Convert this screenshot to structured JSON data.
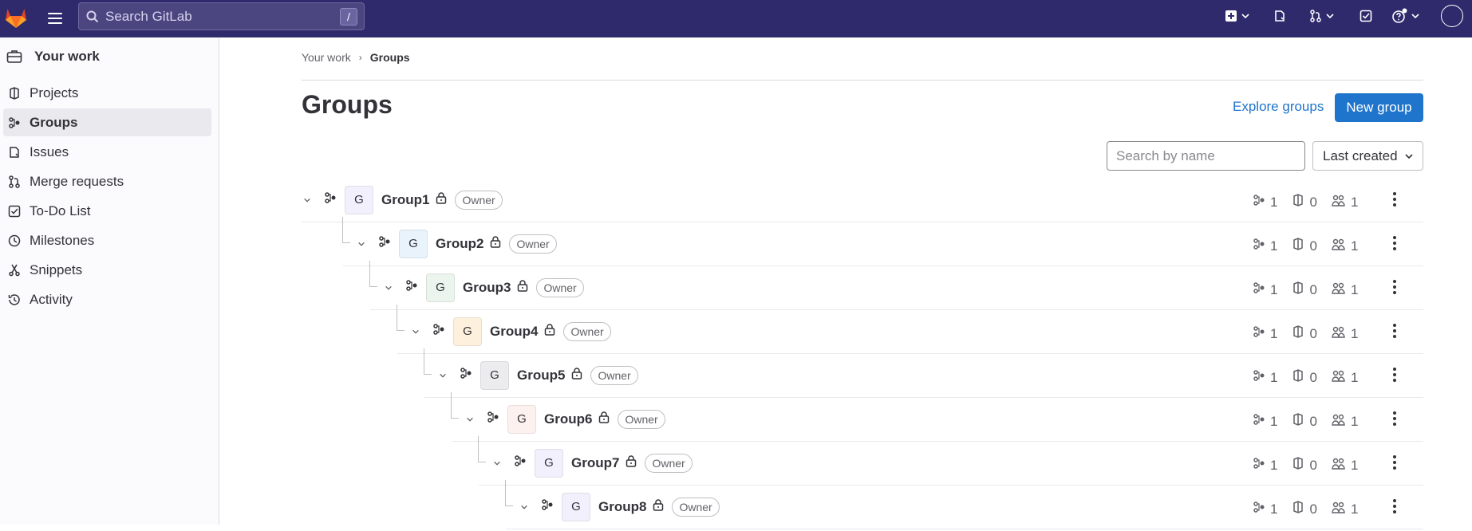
{
  "topbar": {
    "search_placeholder": "Search GitLab",
    "search_shortcut": "/",
    "icons": [
      "gitlab-logo",
      "menu-icon",
      "search-icon",
      "plus-square-icon",
      "issues-icon",
      "merge-request-icon",
      "todo-icon",
      "help-icon",
      "avatar"
    ]
  },
  "sidebar": {
    "title": "Your work",
    "items": [
      {
        "label": "Projects",
        "icon": "project-icon"
      },
      {
        "label": "Groups",
        "icon": "group-icon",
        "active": true
      },
      {
        "label": "Issues",
        "icon": "issues-icon"
      },
      {
        "label": "Merge requests",
        "icon": "merge-request-icon"
      },
      {
        "label": "To-Do List",
        "icon": "todo-icon"
      },
      {
        "label": "Milestones",
        "icon": "clock-icon"
      },
      {
        "label": "Snippets",
        "icon": "snippet-icon"
      },
      {
        "label": "Activity",
        "icon": "history-icon"
      }
    ]
  },
  "breadcrumb": {
    "root": "Your work",
    "current": "Groups"
  },
  "page": {
    "title": "Groups",
    "explore_label": "Explore groups",
    "new_group_label": "New group",
    "search_placeholder": "Search by name",
    "sort_label": "Last created"
  },
  "groups": [
    {
      "name": "Group1",
      "avatar": "G",
      "role": "Owner",
      "subgroups": "1",
      "projects": "0",
      "members": "1",
      "color": "#f2f0fc"
    },
    {
      "name": "Group2",
      "avatar": "G",
      "role": "Owner",
      "subgroups": "1",
      "projects": "0",
      "members": "1",
      "color": "#e9f3fc"
    },
    {
      "name": "Group3",
      "avatar": "G",
      "role": "Owner",
      "subgroups": "1",
      "projects": "0",
      "members": "1",
      "color": "#ecf4ee"
    },
    {
      "name": "Group4",
      "avatar": "G",
      "role": "Owner",
      "subgroups": "1",
      "projects": "0",
      "members": "1",
      "color": "#fdf1dd"
    },
    {
      "name": "Group5",
      "avatar": "G",
      "role": "Owner",
      "subgroups": "1",
      "projects": "0",
      "members": "1",
      "color": "#ececef"
    },
    {
      "name": "Group6",
      "avatar": "G",
      "role": "Owner",
      "subgroups": "1",
      "projects": "0",
      "members": "1",
      "color": "#fcf1ef"
    },
    {
      "name": "Group7",
      "avatar": "G",
      "role": "Owner",
      "subgroups": "1",
      "projects": "0",
      "members": "1",
      "color": "#f2f0fc"
    },
    {
      "name": "Group8",
      "avatar": "G",
      "role": "Owner",
      "subgroups": "1",
      "projects": "0",
      "members": "1",
      "color": "#f2f0fc"
    }
  ],
  "colors": {
    "topbar": "#2f2a6b",
    "primary": "#1f75cb",
    "link": "#1f75cb"
  }
}
